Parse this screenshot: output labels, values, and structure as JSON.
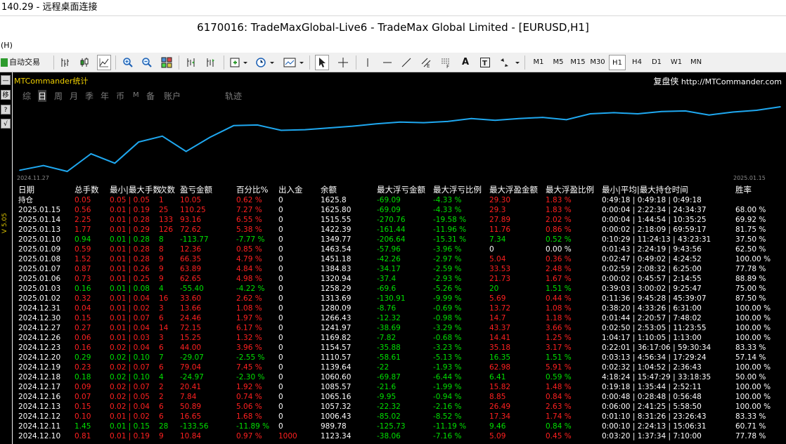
{
  "rdp_title": "140.29 - 远程桌面连接",
  "window_title": "6170016: TradeMaxGlobal-Live6 - TradeMax Global Limited - [EURUSD,H1]",
  "menu_label": "(H)",
  "toolbar": {
    "autotrade_label": "自动交易",
    "text_tool": "A",
    "timeframes": [
      "M1",
      "M5",
      "M15",
      "M30",
      "H1",
      "H4",
      "D1",
      "W1",
      "MN"
    ],
    "active_timeframe": "H1"
  },
  "side": {
    "minus": "—",
    "move": "移",
    "help": "?",
    "check": "√",
    "version": "V 5.05"
  },
  "panel": {
    "title": "MTCommander统计",
    "brand_cn": "复盘侠",
    "brand_url": "http://MTCommander.com",
    "tabs": [
      "综",
      "日",
      "周",
      "月",
      "季",
      "年",
      "币",
      "M",
      "备",
      "账户",
      "轨迹"
    ],
    "active_tab": "日",
    "chart_start": "2024.11.27",
    "chart_end": "2025.01.15"
  },
  "chart_data": {
    "type": "line",
    "x": [
      "2024.11.27",
      "2024.11.28",
      "2024.11.29",
      "2024.12.02",
      "2024.12.03",
      "2024.12.04",
      "2024.12.05",
      "2024.12.06",
      "2024.12.09",
      "2024.12.10",
      "2024.12.11",
      "2024.12.12",
      "2024.12.13",
      "2024.12.16",
      "2024.12.17",
      "2024.12.18",
      "2024.12.19",
      "2024.12.20",
      "2024.12.23",
      "2024.12.26",
      "2024.12.27",
      "2024.12.30",
      "2024.12.31",
      "2025.01.02",
      "2025.01.03",
      "2025.01.06",
      "2025.01.07",
      "2025.01.08",
      "2025.01.09",
      "2025.01.10",
      "2025.01.13",
      "2025.01.14",
      "2025.01.15"
    ],
    "values": [
      1000,
      1040,
      990,
      1140,
      1060,
      1240,
      1290,
      1160,
      1280,
      1380,
      1385,
      1340,
      1345,
      1360,
      1375,
      1395,
      1410,
      1405,
      1415,
      1440,
      1425,
      1440,
      1450,
      1430,
      1480,
      1490,
      1480,
      1500,
      1505,
      1470,
      1495,
      1510,
      1540
    ],
    "color": "#1fa8f0",
    "grid": false
  },
  "table": {
    "headers": [
      "日期",
      "总手数",
      "最小|最大手数",
      "次数",
      "盈亏金额",
      "百分比%",
      "出入金",
      "余额",
      "最大浮亏金额",
      "最大浮亏比例",
      "最大浮盈金额",
      "最大浮盈比例",
      "最小|平均|最大持仓时间",
      "胜率"
    ],
    "rows": [
      {
        "date": "持仓",
        "lots": "0.05",
        "minmax": "0.05 | 0.05",
        "count": "1",
        "pnl": "10.05",
        "pct": "0.62 %",
        "dep": "0",
        "bal": "1625.8",
        "mfl": "-69.09",
        "mflp": "-4.33 %",
        "mfp": "29.30",
        "mfpp": "1.83 %",
        "hold": "0:49:18 | 0:49:18 | 0:49:18",
        "win": "",
        "tone": "red"
      },
      {
        "date": "2025.01.15",
        "lots": "0.56",
        "minmax": "0.01 | 0.19",
        "count": "25",
        "pnl": "110.25",
        "pct": "7.27 %",
        "dep": "0",
        "bal": "1625.80",
        "mfl": "-69.09",
        "mflp": "-4.33 %",
        "mfp": "29.3",
        "mfpp": "1.83 %",
        "hold": "0:00:04 | 2:22:34 | 24:34:37",
        "win": "68.00 %",
        "tone": "red"
      },
      {
        "date": "2025.01.14",
        "lots": "2.25",
        "minmax": "0.01 | 0.28",
        "count": "133",
        "pnl": "93.16",
        "pct": "6.55 %",
        "dep": "0",
        "bal": "1515.55",
        "mfl": "-270.76",
        "mflp": "-19.58 %",
        "mfp": "27.89",
        "mfpp": "2.02 %",
        "hold": "0:00:04 | 1:44:54 | 10:35:25",
        "win": "69.92 %",
        "tone": "red"
      },
      {
        "date": "2025.01.13",
        "lots": "1.77",
        "minmax": "0.01 | 0.29",
        "count": "126",
        "pnl": "72.62",
        "pct": "5.38 %",
        "dep": "0",
        "bal": "1422.39",
        "mfl": "-161.44",
        "mflp": "-11.96 %",
        "mfp": "11.76",
        "mfpp": "0.86 %",
        "hold": "0:00:02 | 2:18:09 | 69:59:17",
        "win": "81.75 %",
        "tone": "red"
      },
      {
        "date": "2025.01.10",
        "lots": "0.94",
        "minmax": "0.01 | 0.28",
        "count": "8",
        "pnl": "-113.77",
        "pct": "-7.77 %",
        "dep": "0",
        "bal": "1349.77",
        "mfl": "-206.64",
        "mflp": "-15.31 %",
        "mfp": "7.34",
        "mfpp": "0.52 %",
        "hold": "0:10:29 | 11:24:13 | 43:23:31",
        "win": "37.50 %",
        "tone": "green"
      },
      {
        "date": "2025.01.09",
        "lots": "0.59",
        "minmax": "0.01 | 0.28",
        "count": "8",
        "pnl": "12.36",
        "pct": "0.85 %",
        "dep": "0",
        "bal": "1463.54",
        "mfl": "-57.96",
        "mflp": "-3.96 %",
        "mfp": "0",
        "mfpp": "0.00 %",
        "hold": "0:01:43 | 2:24:19 | 9:43:56",
        "win": "62.50 %",
        "tone": "red"
      },
      {
        "date": "2025.01.08",
        "lots": "1.52",
        "minmax": "0.01 | 0.28",
        "count": "9",
        "pnl": "66.35",
        "pct": "4.79 %",
        "dep": "0",
        "bal": "1451.18",
        "mfl": "-42.26",
        "mflp": "-2.97 %",
        "mfp": "5.04",
        "mfpp": "0.36 %",
        "hold": "0:02:47 | 0:49:02 | 4:24:52",
        "win": "100.00 %",
        "tone": "red"
      },
      {
        "date": "2025.01.07",
        "lots": "0.87",
        "minmax": "0.01 | 0.26",
        "count": "9",
        "pnl": "63.89",
        "pct": "4.84 %",
        "dep": "0",
        "bal": "1384.83",
        "mfl": "-34.17",
        "mflp": "-2.59 %",
        "mfp": "33.53",
        "mfpp": "2.48 %",
        "hold": "0:02:59 | 2:08:32 | 6:25:00",
        "win": "77.78 %",
        "tone": "red"
      },
      {
        "date": "2025.01.06",
        "lots": "0.73",
        "minmax": "0.01 | 0.25",
        "count": "9",
        "pnl": "62.65",
        "pct": "4.98 %",
        "dep": "0",
        "bal": "1320.94",
        "mfl": "-37.4",
        "mflp": "-2.93 %",
        "mfp": "21.73",
        "mfpp": "1.67 %",
        "hold": "0:00:02 | 0:45:57 | 2:14:55",
        "win": "88.89 %",
        "tone": "red"
      },
      {
        "date": "2025.01.03",
        "lots": "0.16",
        "minmax": "0.01 | 0.08",
        "count": "4",
        "pnl": "-55.40",
        "pct": "-4.22 %",
        "dep": "0",
        "bal": "1258.29",
        "mfl": "-69.6",
        "mflp": "-5.26 %",
        "mfp": "20",
        "mfpp": "1.51 %",
        "hold": "0:39:03 | 3:00:02 | 9:25:47",
        "win": "75.00 %",
        "tone": "green"
      },
      {
        "date": "2025.01.02",
        "lots": "0.32",
        "minmax": "0.01 | 0.04",
        "count": "16",
        "pnl": "33.60",
        "pct": "2.62 %",
        "dep": "0",
        "bal": "1313.69",
        "mfl": "-130.91",
        "mflp": "-9.99 %",
        "mfp": "5.69",
        "mfpp": "0.44 %",
        "hold": "0:11:36 | 9:45:28 | 45:39:07",
        "win": "87.50 %",
        "tone": "red"
      },
      {
        "date": "2024.12.31",
        "lots": "0.04",
        "minmax": "0.01 | 0.02",
        "count": "3",
        "pnl": "13.66",
        "pct": "1.08 %",
        "dep": "0",
        "bal": "1280.09",
        "mfl": "-8.76",
        "mflp": "-0.69 %",
        "mfp": "13.72",
        "mfpp": "1.08 %",
        "hold": "0:38:20 | 4:33:26 | 6:31:00",
        "win": "100.00 %",
        "tone": "red"
      },
      {
        "date": "2024.12.30",
        "lots": "0.15",
        "minmax": "0.01 | 0.07",
        "count": "6",
        "pnl": "24.46",
        "pct": "1.97 %",
        "dep": "0",
        "bal": "1266.43",
        "mfl": "-12.32",
        "mflp": "-0.98 %",
        "mfp": "14.7",
        "mfpp": "1.18 %",
        "hold": "0:01:44 | 2:20:57 | 7:48:02",
        "win": "100.00 %",
        "tone": "red"
      },
      {
        "date": "2024.12.27",
        "lots": "0.27",
        "minmax": "0.01 | 0.04",
        "count": "14",
        "pnl": "72.15",
        "pct": "6.17 %",
        "dep": "0",
        "bal": "1241.97",
        "mfl": "-38.69",
        "mflp": "-3.29 %",
        "mfp": "43.37",
        "mfpp": "3.66 %",
        "hold": "0:02:50 | 2:53:05 | 11:23:55",
        "win": "100.00 %",
        "tone": "red"
      },
      {
        "date": "2024.12.26",
        "lots": "0.06",
        "minmax": "0.01 | 0.03",
        "count": "3",
        "pnl": "15.25",
        "pct": "1.32 %",
        "dep": "0",
        "bal": "1169.82",
        "mfl": "-7.82",
        "mflp": "-0.68 %",
        "mfp": "14.41",
        "mfpp": "1.25 %",
        "hold": "1:04:17 | 1:10:05 | 1:13:00",
        "win": "100.00 %",
        "tone": "red"
      },
      {
        "date": "2024.12.23",
        "lots": "0.16",
        "minmax": "0.02 | 0.04",
        "count": "6",
        "pnl": "44.00",
        "pct": "3.96 %",
        "dep": "0",
        "bal": "1154.57",
        "mfl": "-35.88",
        "mflp": "-3.23 %",
        "mfp": "35.18",
        "mfpp": "3.17 %",
        "hold": "0:22:01 | 36:17:06 | 59:30:34",
        "win": "83.33 %",
        "tone": "red"
      },
      {
        "date": "2024.12.20",
        "lots": "0.29",
        "minmax": "0.02 | 0.10",
        "count": "7",
        "pnl": "-29.07",
        "pct": "-2.55 %",
        "dep": "0",
        "bal": "1110.57",
        "mfl": "-58.61",
        "mflp": "-5.13 %",
        "mfp": "16.35",
        "mfpp": "1.51 %",
        "hold": "0:03:13 | 4:56:34 | 17:29:24",
        "win": "57.14 %",
        "tone": "green"
      },
      {
        "date": "2024.12.19",
        "lots": "0.23",
        "minmax": "0.02 | 0.07",
        "count": "6",
        "pnl": "79.04",
        "pct": "7.45 %",
        "dep": "0",
        "bal": "1139.64",
        "mfl": "-22",
        "mflp": "-1.93 %",
        "mfp": "62.98",
        "mfpp": "5.91 %",
        "hold": "0:02:32 | 1:04:52 | 2:36:43",
        "win": "100.00 %",
        "tone": "red"
      },
      {
        "date": "2024.12.18",
        "lots": "0.18",
        "minmax": "0.02 | 0.10",
        "count": "4",
        "pnl": "-24.97",
        "pct": "-2.30 %",
        "dep": "0",
        "bal": "1060.60",
        "mfl": "-69.87",
        "mflp": "-6.44 %",
        "mfp": "6.41",
        "mfpp": "0.59 %",
        "hold": "4:18:24 | 15:47:29 | 33:18:35",
        "win": "50.00 %",
        "tone": "green"
      },
      {
        "date": "2024.12.17",
        "lots": "0.09",
        "minmax": "0.02 | 0.07",
        "count": "2",
        "pnl": "20.41",
        "pct": "1.92 %",
        "dep": "0",
        "bal": "1085.57",
        "mfl": "-21.6",
        "mflp": "-1.99 %",
        "mfp": "15.82",
        "mfpp": "1.48 %",
        "hold": "0:19:18 | 1:35:44 | 2:52:11",
        "win": "100.00 %",
        "tone": "red"
      },
      {
        "date": "2024.12.16",
        "lots": "0.07",
        "minmax": "0.02 | 0.05",
        "count": "2",
        "pnl": "7.84",
        "pct": "0.74 %",
        "dep": "0",
        "bal": "1065.16",
        "mfl": "-9.95",
        "mflp": "-0.94 %",
        "mfp": "8.85",
        "mfpp": "0.84 %",
        "hold": "0:00:48 | 0:28:48 | 0:56:48",
        "win": "100.00 %",
        "tone": "red"
      },
      {
        "date": "2024.12.13",
        "lots": "0.15",
        "minmax": "0.02 | 0.04",
        "count": "6",
        "pnl": "50.89",
        "pct": "5.06 %",
        "dep": "0",
        "bal": "1057.32",
        "mfl": "-22.32",
        "mflp": "-2.16 %",
        "mfp": "26.49",
        "mfpp": "2.63 %",
        "hold": "0:06:00 | 2:41:25 | 5:58:50",
        "win": "100.00 %",
        "tone": "red"
      },
      {
        "date": "2024.12.12",
        "lots": "0.10",
        "minmax": "0.01 | 0.02",
        "count": "6",
        "pnl": "16.65",
        "pct": "1.68 %",
        "dep": "0",
        "bal": "1006.43",
        "mfl": "-85.02",
        "mflp": "-8.52 %",
        "mfp": "17.34",
        "mfpp": "1.74 %",
        "hold": "0:01:10 | 8:31:26 | 23:26:43",
        "win": "83.33 %",
        "tone": "red"
      },
      {
        "date": "2024.12.11",
        "lots": "1.45",
        "minmax": "0.01 | 0.15",
        "count": "28",
        "pnl": "-133.56",
        "pct": "-11.89 %",
        "dep": "0",
        "bal": "989.78",
        "mfl": "-125.73",
        "mflp": "-11.19 %",
        "mfp": "9.46",
        "mfpp": "0.84 %",
        "hold": "0:00:10 | 2:24:13 | 15:06:31",
        "win": "60.71 %",
        "tone": "green"
      },
      {
        "date": "2024.12.10",
        "lots": "0.81",
        "minmax": "0.01 | 0.19",
        "count": "9",
        "pnl": "10.84",
        "pct": "0.97 %",
        "dep": "1000",
        "bal": "1123.34",
        "mfl": "-38.06",
        "mflp": "-7.16 %",
        "mfp": "5.09",
        "mfpp": "0.45 %",
        "hold": "0:03:20 | 1:37:34 | 7:10:00",
        "win": "77.78 %",
        "tone": "red"
      }
    ]
  }
}
